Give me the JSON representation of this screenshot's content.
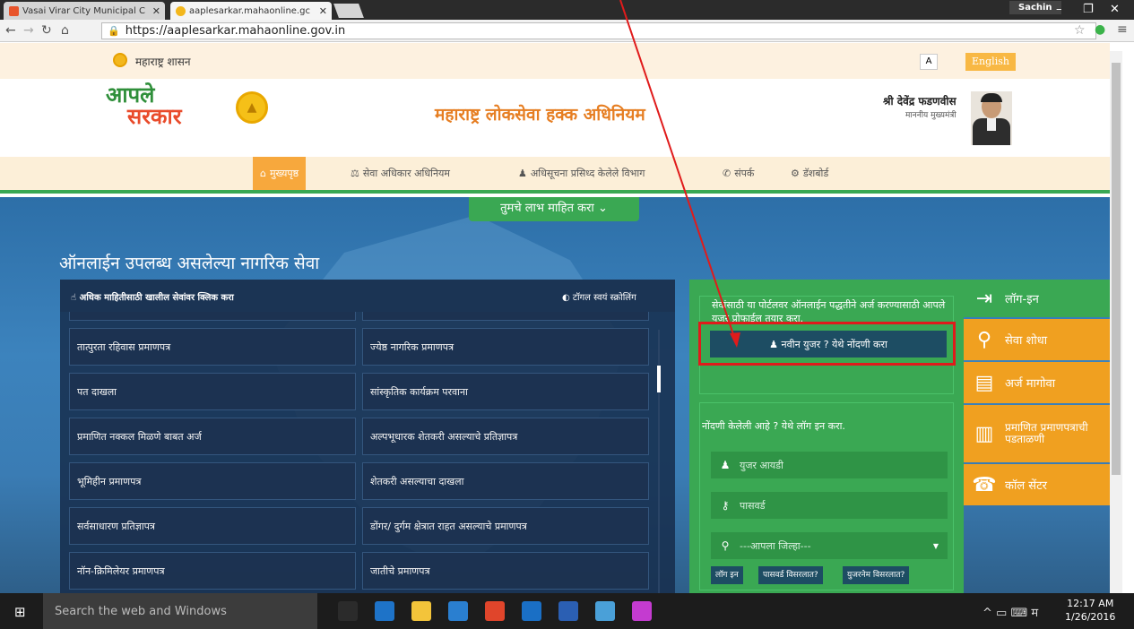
{
  "browser": {
    "tabs": [
      {
        "title": "Vasai Virar City Municipal C",
        "icon_color": "#e8542b"
      },
      {
        "title": "aaplesarkar.mahaonline.gc",
        "icon_color": "#f3b71d"
      }
    ],
    "user": "Sachin",
    "url": "https://aaplesarkar.mahaonline.gov.in",
    "window_buttons": [
      "–",
      "❐",
      "✕"
    ]
  },
  "gov_strip": {
    "title": "महाराष्ट्र शासन",
    "font_button": "A",
    "language_button": "English"
  },
  "header": {
    "logo_line1": "आपले",
    "logo_line2": "सरकार",
    "title": "महाराष्ट्र लोकसेवा हक्क अधिनियम",
    "cm_name": "श्री देवेंद्र फडणवीस",
    "cm_role": "माननीय मुख्यमंत्री"
  },
  "nav": {
    "items": [
      {
        "label": "मुख्यपृष्ठ",
        "icon": "home-icon",
        "active": true
      },
      {
        "label": "सेवा अधिकार अधिनियम",
        "icon": "gavel-icon",
        "active": false
      },
      {
        "label": "अधिसूचना प्रसिध्द केलेले विभाग",
        "icon": "user-icon",
        "active": false
      },
      {
        "label": "संपर्क",
        "icon": "phone-icon",
        "active": false
      },
      {
        "label": "डॅशबोर्ड",
        "icon": "gears-icon",
        "active": false
      }
    ]
  },
  "hero": {
    "benefit_tab": "तुमचे लाभ माहित करा",
    "title": "ऑनलाईन उपलब्ध असलेल्या नागरिक सेवा",
    "services_hint": "अधिक माहितीसाठी खालील सेवांवर क्लिक करा",
    "toggle_label": "टॉगल स्वयं स्क्रोलिंग",
    "services": [
      [
        "तात्पुरता रहिवास प्रमाणपत्र",
        "ज्येष्ठ नागरिक प्रमाणपत्र"
      ],
      [
        "पत दाखला",
        "सांस्कृतिक कार्यक्रम परवाना"
      ],
      [
        "प्रमाणित नक्कल मिळणे बाबत अर्ज",
        "अल्पभूधारक शेतकरी असल्याचे प्रतिज्ञापत्र"
      ],
      [
        "भूमिहीन प्रमाणपत्र",
        "शेतकरी असल्याचा दाखला"
      ],
      [
        "सर्वसाधारण प्रतिज्ञापत्र",
        "डोंगर/ दुर्गम क्षेत्रात राहत असल्याचे प्रमाणपत्र"
      ],
      [
        "नॉन-क्रिमिलेयर प्रमाणपत्र",
        "जातीचे प्रमाणपत्र"
      ]
    ]
  },
  "register": {
    "text": "सेवांसाठी या पोर्टलवर ऑनलाईन पद्धतीने अर्ज करण्यासाठी आपले युजर प्रोफाईल तयार करा.",
    "button": "नवीन युजर ? येथे नोंदणी करा"
  },
  "login": {
    "title": "नोंदणी केलेली आहे ? येथे लॉग इन करा.",
    "user_placeholder": "युजर आयडी",
    "password_placeholder": "पासवर्ड",
    "district": "---आपला जिल्हा---",
    "login_button": "लॉग इन",
    "forgot_password": "पासवर्ड विसरलात?",
    "forgot_username": "युजरनेम विसरलात?"
  },
  "side_menu": [
    {
      "label": "लॉग-इन",
      "icon": "sign-in-icon",
      "color": "#3aa853"
    },
    {
      "label": "सेवा शोधा",
      "icon": "search-icon",
      "color": "#f0a020"
    },
    {
      "label": "अर्ज मागोवा",
      "icon": "document-icon",
      "color": "#f0a020"
    },
    {
      "label": "प्रमाणित प्रमाणपत्राची पडताळणी",
      "icon": "barcode-icon",
      "color": "#f0a020"
    },
    {
      "label": "कॉल सेंटर",
      "icon": "phone-icon",
      "color": "#f0a020"
    }
  ],
  "taskbar": {
    "search_placeholder": "Search the web and Windows",
    "apps": [
      {
        "name": "task-view",
        "color": "#2b2b2b"
      },
      {
        "name": "edge",
        "color": "#1e73c8"
      },
      {
        "name": "file-explorer",
        "color": "#f3c43a"
      },
      {
        "name": "store",
        "color": "#2a7fd0"
      },
      {
        "name": "chrome",
        "color": "#e0452b"
      },
      {
        "name": "outlook",
        "color": "#1a6fc5"
      },
      {
        "name": "word",
        "color": "#2b5fb3"
      },
      {
        "name": "app",
        "color": "#4aa0d8"
      },
      {
        "name": "paint",
        "color": "#c43bd0"
      }
    ],
    "ime": "म",
    "time": "12:17 AM",
    "date": "1/26/2016"
  }
}
